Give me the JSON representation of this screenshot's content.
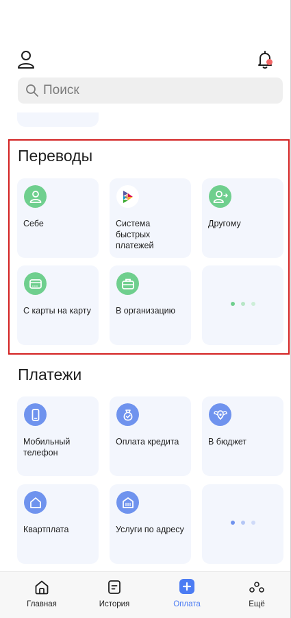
{
  "search": {
    "placeholder": "Поиск"
  },
  "sections": {
    "transfers": {
      "title": "Переводы",
      "tiles": [
        {
          "label": "Себе",
          "icon": "person-icon"
        },
        {
          "label": "Система быстрых платежей",
          "icon": "sbp-logo-icon"
        },
        {
          "label": "Другому",
          "icon": "person-arrow-icon"
        },
        {
          "label": "С карты на карту",
          "icon": "card-icon"
        },
        {
          "label": "В организацию",
          "icon": "briefcase-icon"
        },
        {
          "label": "",
          "icon": "more-dots-icon"
        }
      ]
    },
    "payments": {
      "title": "Платежи",
      "tiles": [
        {
          "label": "Мобильный телефон",
          "icon": "phone-icon"
        },
        {
          "label": "Оплата кредита",
          "icon": "money-bag-icon"
        },
        {
          "label": "В бюджет",
          "icon": "coat-of-arms-icon"
        },
        {
          "label": "Квартплата",
          "icon": "house-icon"
        },
        {
          "label": "Услуги по адресу",
          "icon": "building-icon"
        },
        {
          "label": "",
          "icon": "more-dots-icon"
        }
      ]
    }
  },
  "tabbar": {
    "items": [
      {
        "label": "Главная",
        "icon": "home-icon"
      },
      {
        "label": "История",
        "icon": "history-icon"
      },
      {
        "label": "Оплата",
        "icon": "plus-icon",
        "active": true
      },
      {
        "label": "Ещё",
        "icon": "more-icon"
      }
    ]
  },
  "colors": {
    "accent": "#4c7cf3",
    "green_icon": "#6fcf8e",
    "blue_icon": "#6f93ee",
    "tile_bg": "#f3f6fd",
    "highlight_border": "#d32121",
    "notification_dot": "#f26666"
  }
}
